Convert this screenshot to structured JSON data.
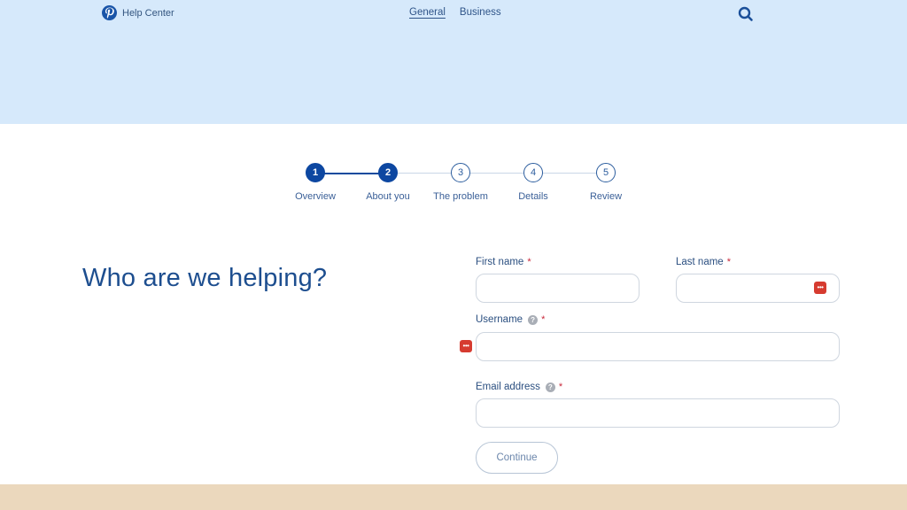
{
  "header": {
    "brand": "Help Center",
    "nav": [
      {
        "label": "General",
        "active": true
      },
      {
        "label": "Business",
        "active": false
      }
    ],
    "search_icon": "search-icon"
  },
  "stepper": {
    "current_step": 2,
    "steps": [
      {
        "number": "1",
        "label": "Overview",
        "state": "complete"
      },
      {
        "number": "2",
        "label": "About you",
        "state": "current"
      },
      {
        "number": "3",
        "label": "The problem",
        "state": "upcoming"
      },
      {
        "number": "4",
        "label": "Details",
        "state": "upcoming"
      },
      {
        "number": "5",
        "label": "Review",
        "state": "upcoming"
      }
    ]
  },
  "form": {
    "heading": "Who are we helping?",
    "required_mark": "*",
    "help_glyph": "?",
    "fields": {
      "first_name": {
        "label": "First name",
        "value": "",
        "placeholder": ""
      },
      "last_name": {
        "label": "Last name",
        "value": "",
        "placeholder": ""
      },
      "username": {
        "label": "Username",
        "value": "",
        "placeholder": ""
      },
      "email": {
        "label": "Email address",
        "value": "",
        "placeholder": ""
      }
    },
    "password_manager_glyph": "•••",
    "continue_label": "Continue"
  },
  "colors": {
    "header_bg": "#d6e9fb",
    "accent": "#0d47a1",
    "required": "#c8283a",
    "footer_bg": "#ebd8bd"
  }
}
